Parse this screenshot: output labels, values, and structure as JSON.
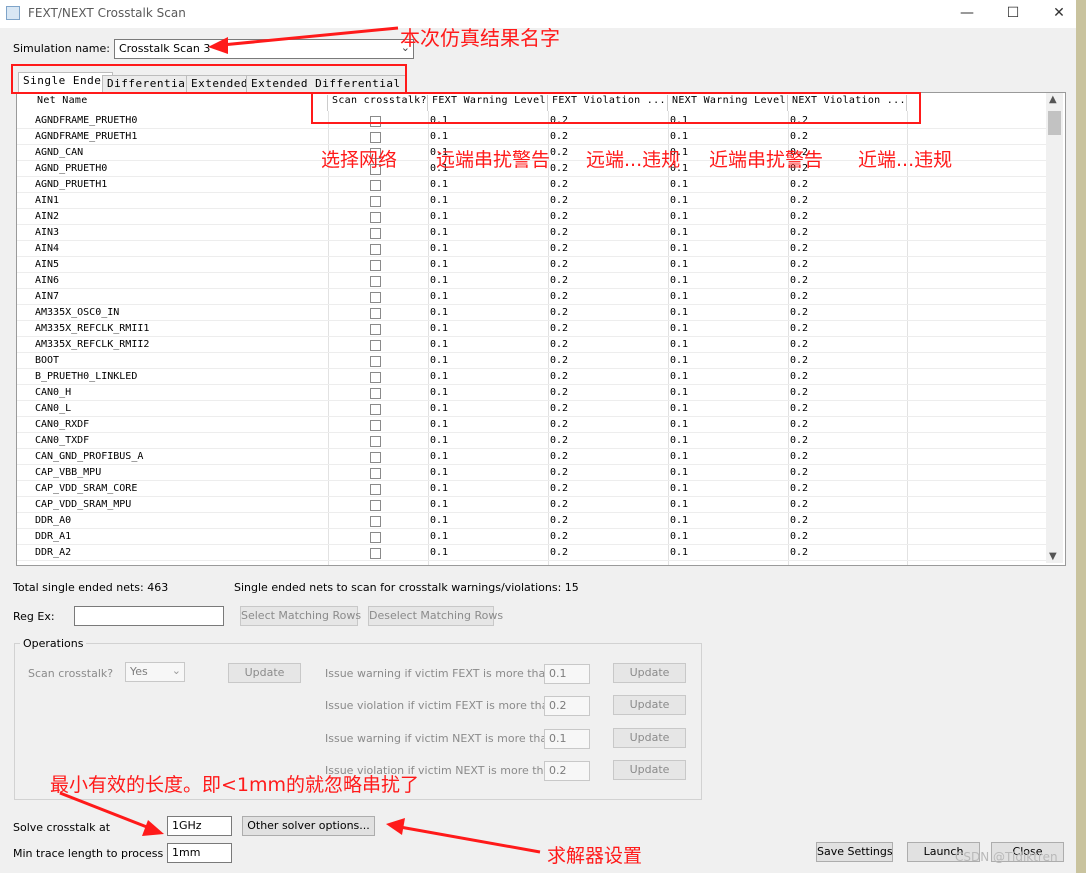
{
  "window": {
    "title": "FEXT/NEXT Crosstalk Scan",
    "minimize": "—",
    "maximize": "☐",
    "close": "✕"
  },
  "simulation": {
    "label": "Simulation name:",
    "value": "Crosstalk Scan 3"
  },
  "tabs": [
    "Single Ended",
    "Differential",
    "Extended",
    "Extended Differential"
  ],
  "columns": [
    "Net Name",
    "Scan crosstalk?",
    "FEXT Warning Level",
    "FEXT Violation ...",
    "NEXT Warning Level",
    "NEXT Violation ..."
  ],
  "rows": [
    {
      "net": "AGNDFRAME_PRUETH0",
      "fw": "0.1",
      "fv": "0.2",
      "nw": "0.1",
      "nv": "0.2"
    },
    {
      "net": "AGNDFRAME_PRUETH1",
      "fw": "0.1",
      "fv": "0.2",
      "nw": "0.1",
      "nv": "0.2"
    },
    {
      "net": "AGND_CAN",
      "fw": "0.1",
      "fv": "0.2",
      "nw": "0.1",
      "nv": "0.2"
    },
    {
      "net": "AGND_PRUETH0",
      "fw": "0.1",
      "fv": "0.2",
      "nw": "0.1",
      "nv": "0.2"
    },
    {
      "net": "AGND_PRUETH1",
      "fw": "0.1",
      "fv": "0.2",
      "nw": "0.1",
      "nv": "0.2"
    },
    {
      "net": "AIN1",
      "fw": "0.1",
      "fv": "0.2",
      "nw": "0.1",
      "nv": "0.2"
    },
    {
      "net": "AIN2",
      "fw": "0.1",
      "fv": "0.2",
      "nw": "0.1",
      "nv": "0.2"
    },
    {
      "net": "AIN3",
      "fw": "0.1",
      "fv": "0.2",
      "nw": "0.1",
      "nv": "0.2"
    },
    {
      "net": "AIN4",
      "fw": "0.1",
      "fv": "0.2",
      "nw": "0.1",
      "nv": "0.2"
    },
    {
      "net": "AIN5",
      "fw": "0.1",
      "fv": "0.2",
      "nw": "0.1",
      "nv": "0.2"
    },
    {
      "net": "AIN6",
      "fw": "0.1",
      "fv": "0.2",
      "nw": "0.1",
      "nv": "0.2"
    },
    {
      "net": "AIN7",
      "fw": "0.1",
      "fv": "0.2",
      "nw": "0.1",
      "nv": "0.2"
    },
    {
      "net": "AM335X_OSC0_IN",
      "fw": "0.1",
      "fv": "0.2",
      "nw": "0.1",
      "nv": "0.2"
    },
    {
      "net": "AM335X_REFCLK_RMII1",
      "fw": "0.1",
      "fv": "0.2",
      "nw": "0.1",
      "nv": "0.2"
    },
    {
      "net": "AM335X_REFCLK_RMII2",
      "fw": "0.1",
      "fv": "0.2",
      "nw": "0.1",
      "nv": "0.2"
    },
    {
      "net": "BOOT",
      "fw": "0.1",
      "fv": "0.2",
      "nw": "0.1",
      "nv": "0.2"
    },
    {
      "net": "B_PRUETH0_LINKLED",
      "fw": "0.1",
      "fv": "0.2",
      "nw": "0.1",
      "nv": "0.2"
    },
    {
      "net": "CAN0_H",
      "fw": "0.1",
      "fv": "0.2",
      "nw": "0.1",
      "nv": "0.2"
    },
    {
      "net": "CAN0_L",
      "fw": "0.1",
      "fv": "0.2",
      "nw": "0.1",
      "nv": "0.2"
    },
    {
      "net": "CAN0_RXDF",
      "fw": "0.1",
      "fv": "0.2",
      "nw": "0.1",
      "nv": "0.2"
    },
    {
      "net": "CAN0_TXDF",
      "fw": "0.1",
      "fv": "0.2",
      "nw": "0.1",
      "nv": "0.2"
    },
    {
      "net": "CAN_GND_PROFIBUS_A",
      "fw": "0.1",
      "fv": "0.2",
      "nw": "0.1",
      "nv": "0.2"
    },
    {
      "net": "CAP_VBB_MPU",
      "fw": "0.1",
      "fv": "0.2",
      "nw": "0.1",
      "nv": "0.2"
    },
    {
      "net": "CAP_VDD_SRAM_CORE",
      "fw": "0.1",
      "fv": "0.2",
      "nw": "0.1",
      "nv": "0.2"
    },
    {
      "net": "CAP_VDD_SRAM_MPU",
      "fw": "0.1",
      "fv": "0.2",
      "nw": "0.1",
      "nv": "0.2"
    },
    {
      "net": "DDR_A0",
      "fw": "0.1",
      "fv": "0.2",
      "nw": "0.1",
      "nv": "0.2"
    },
    {
      "net": "DDR_A1",
      "fw": "0.1",
      "fv": "0.2",
      "nw": "0.1",
      "nv": "0.2"
    },
    {
      "net": "DDR_A2",
      "fw": "0.1",
      "fv": "0.2",
      "nw": "0.1",
      "nv": "0.2"
    }
  ],
  "summary": {
    "total": "Total single ended nets: 463",
    "to_scan": "Single ended nets to scan for crosstalk warnings/violations: 15"
  },
  "regex": {
    "label": "Reg Ex:",
    "value": "",
    "select": "Select Matching Rows",
    "deselect": "Deselect Matching Rows"
  },
  "operations": {
    "title": "Operations",
    "scan_label": "Scan crosstalk?",
    "scan_value": "Yes",
    "update": "Update",
    "fext_warn_label": "Issue warning if victim FEXT is more than",
    "fext_warn_value": "0.1",
    "fext_viol_label": "Issue violation if victim FEXT is more than",
    "fext_viol_value": "0.2",
    "next_warn_label": "Issue warning if victim NEXT is more than",
    "next_warn_value": "0.1",
    "next_viol_label": "Issue violation if victim NEXT is more than",
    "next_viol_value": "0.2"
  },
  "solver": {
    "solve_label": "Solve crosstalk at",
    "solve_value": "1GHz",
    "other_options": "Other solver options...",
    "min_len_label": "Min trace length to process",
    "min_len_value": "1mm"
  },
  "footer": {
    "save": "Save Settings",
    "launch": "Launch",
    "close": "Close"
  },
  "annotations": {
    "sim_name": "本次仿真结果名字",
    "select_net": "选择网络",
    "fext_warn": "远端串扰警告",
    "fext_viol": "远端...违规",
    "next_warn": "近端串扰警告",
    "next_viol": "近端...违规",
    "min_length": "最小有效的长度。即<1mm的就忽略串扰了",
    "solver": "求解器设置"
  },
  "watermark": "CSDN @Tidiktren",
  "colors": {
    "annotation": "#ff1a1a"
  }
}
